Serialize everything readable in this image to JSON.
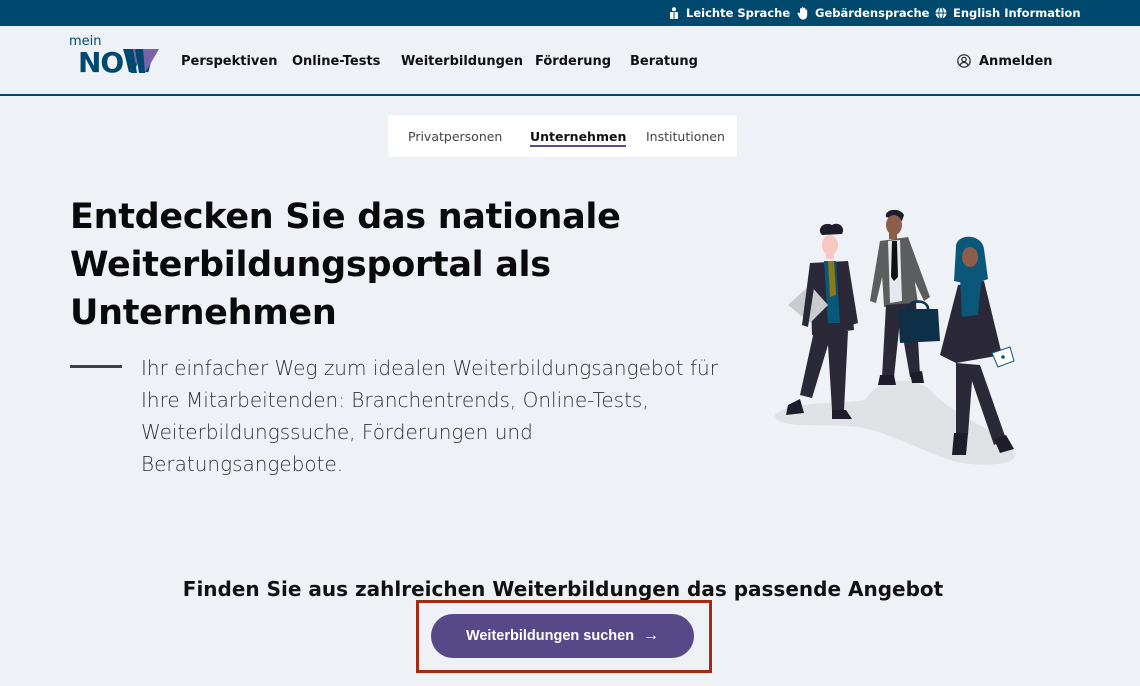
{
  "topbar": {
    "items": [
      {
        "label": "Leichte Sprache",
        "icon": "easy-language-icon"
      },
      {
        "label": "Gebärdensprache",
        "icon": "hand-icon"
      },
      {
        "label": "English Information",
        "icon": "globe-icon"
      }
    ]
  },
  "header": {
    "logo": {
      "small": "mein",
      "main": "NOW"
    },
    "nav": [
      "Perspektiven",
      "Online-Tests",
      "Weiterbildungen",
      "Förderung",
      "Beratung"
    ],
    "login_label": "Anmelden"
  },
  "audience_tabs": {
    "items": [
      "Privatpersonen",
      "Unternehmen",
      "Institutionen"
    ],
    "active": "Unternehmen"
  },
  "hero": {
    "title": "Entdecken Sie das nationale Weiterbildungsportal als Unternehmen",
    "intro": "Ihr einfacher Weg zum idealen Weiterbildungsangebot für Ihre Mitarbeitenden: Branchentrends, Online-Tests, Weiterbildungssuche, Förderungen und Beratungsangebote."
  },
  "cta": {
    "title": "Finden Sie aus zahlreichen Weiterbildungen das passende Angebot",
    "button_label": "Weiterbildungen suchen",
    "button_arrow": "→"
  },
  "colors": {
    "brand_dark": "#00496e",
    "accent_purple": "#574887",
    "highlight_frame": "#a52a10",
    "background": "#eef1f5"
  }
}
